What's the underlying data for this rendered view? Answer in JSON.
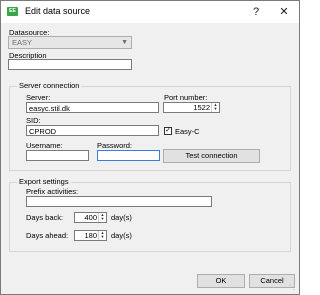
{
  "window": {
    "title": "Edit data source",
    "app_icon": "EE",
    "help_glyph": "?",
    "close_glyph": "✕"
  },
  "datasource": {
    "label": "Datasource:",
    "selected": "EASY"
  },
  "description": {
    "label": "Description",
    "value": ""
  },
  "server_connection": {
    "title": "Server connection",
    "server_label": "Server:",
    "server_value": "easyc.stil.dk",
    "port_label": "Port number:",
    "port_value": "1522",
    "sid_label": "SID:",
    "sid_value": "CPROD",
    "easyc_label": "Easy-C",
    "easyc_checked": true,
    "username_label": "Username:",
    "username_value": "",
    "password_label": "Password:",
    "password_value": "",
    "test_button": "Test connection"
  },
  "export_settings": {
    "title": "Export settings",
    "prefix_label": "Prefix activities:",
    "prefix_value": "",
    "days_back_label": "Days back:",
    "days_back_value": "400",
    "days_ahead_label": "Days ahead:",
    "days_ahead_value": "180",
    "unit": "day(s)"
  },
  "footer": {
    "ok": "OK",
    "cancel": "Cancel"
  }
}
